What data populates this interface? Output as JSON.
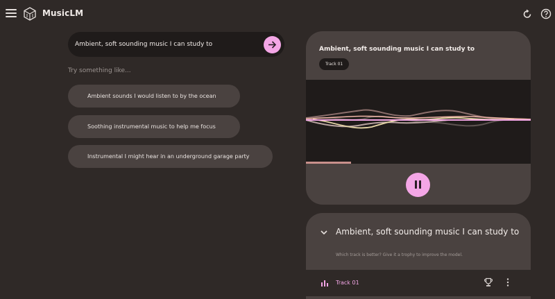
{
  "app": {
    "title": "MusicLM",
    "icons": {
      "menu": "hamburger-menu-icon",
      "logo": "cube-logo-icon",
      "refresh": "refresh-icon",
      "help": "help-icon"
    }
  },
  "prompt": {
    "value": "Ambient, soft sounding music I can study to",
    "submit_icon": "arrow-right-icon"
  },
  "suggestions": {
    "label": "Try something like...",
    "items": [
      "Ambient sounds I would listen to by the ocean",
      "Soothing instrumental music to help me focus",
      "Instrumental I might hear in an underground garage party"
    ]
  },
  "player": {
    "title": "Ambient, soft sounding music I can study to",
    "track_badge": "Track 01",
    "progress": 0.2,
    "control_icon": "pause-icon"
  },
  "result": {
    "title": "Ambient, soft sounding music I can study to",
    "hint": "Which track is better? Give it a trophy to improve the model.",
    "tracks": [
      {
        "name": "Track 01",
        "status_icon": "playing-bars-icon",
        "action_icons": [
          "trophy-icon",
          "more-vert-icon"
        ]
      }
    ]
  },
  "colors": {
    "background": "#2f2927",
    "surface": "#4a4240",
    "dark_surface": "#1f1b1a",
    "accent": "#f4a6e6",
    "progress": "#c9908c"
  }
}
